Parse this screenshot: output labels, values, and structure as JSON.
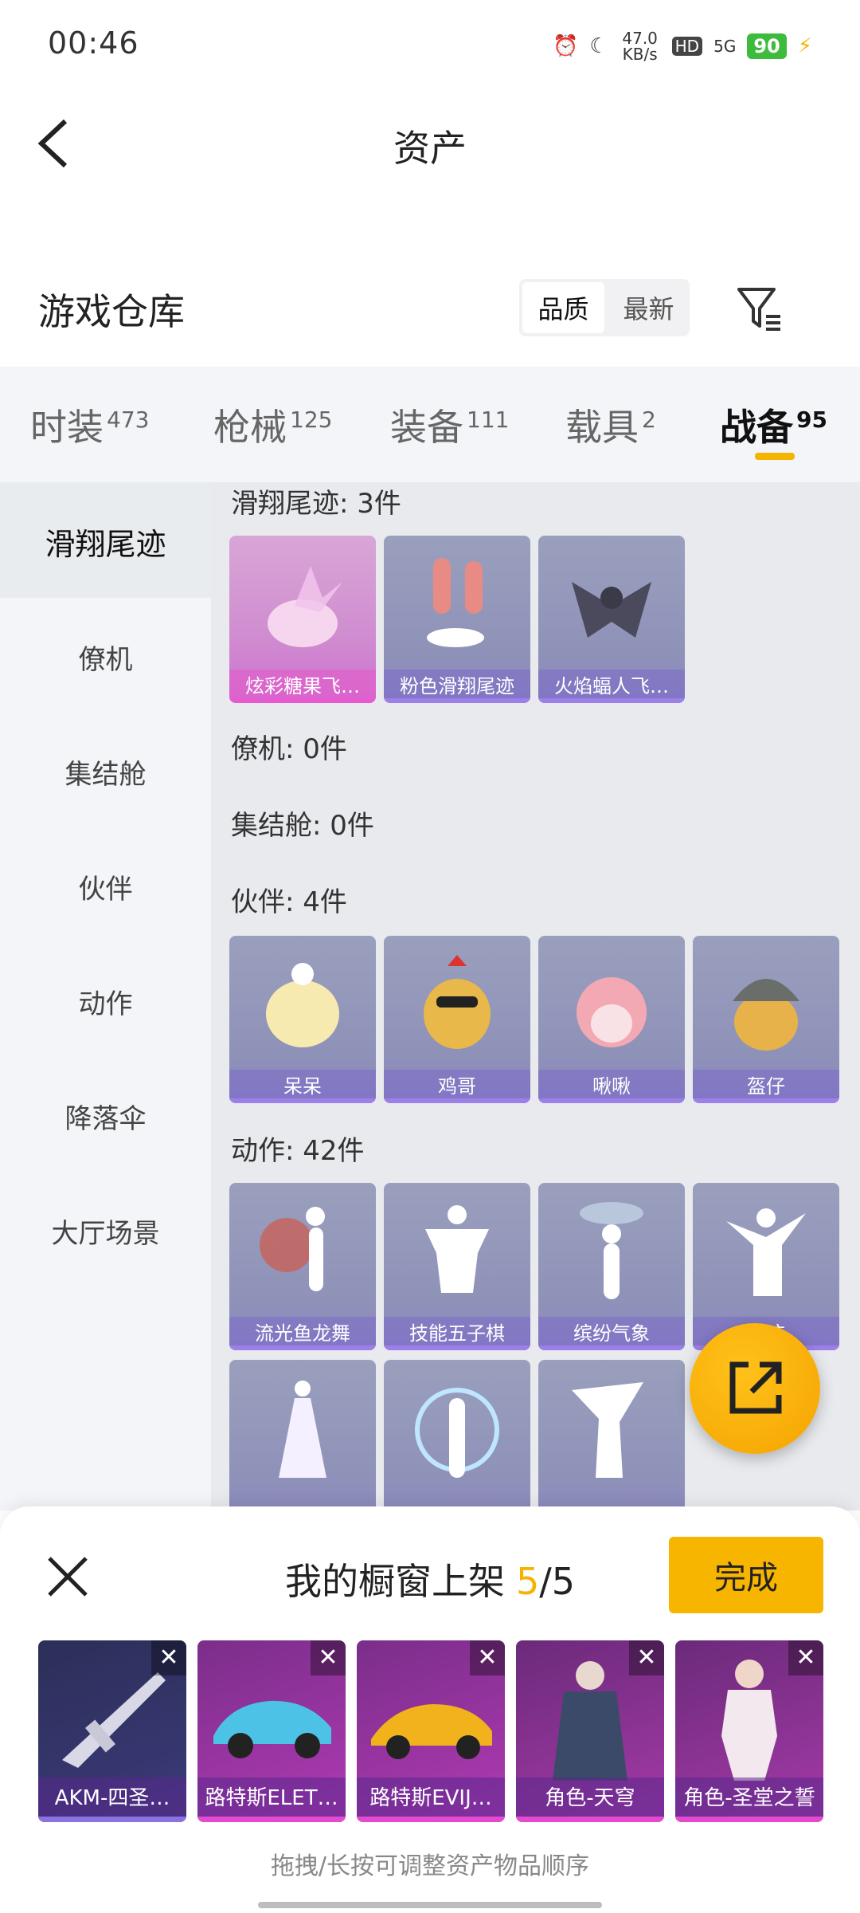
{
  "status": {
    "time": "00:46",
    "net_speed": "47.0 KB/s",
    "hd": "HD",
    "signal": "5G",
    "battery": "90"
  },
  "header": {
    "title": "资产"
  },
  "section": {
    "title": "游戏仓库",
    "sort_options": [
      "品质",
      "最新"
    ],
    "sort_selected": "品质"
  },
  "tabs": [
    {
      "label": "时装",
      "count": "473"
    },
    {
      "label": "枪械",
      "count": "125"
    },
    {
      "label": "装备",
      "count": "111"
    },
    {
      "label": "载具",
      "count": "2"
    },
    {
      "label": "战备",
      "count": "95",
      "active": true
    }
  ],
  "sidebar": {
    "items": [
      "滑翔尾迹",
      "僚机",
      "集结舱",
      "伙伴",
      "动作",
      "降落伞",
      "大厅场景"
    ],
    "active": "滑翔尾迹"
  },
  "content": {
    "groups": [
      {
        "title": "滑翔尾迹: 3件",
        "items": [
          "炫彩糖果飞…",
          "粉色滑翔尾迹",
          "火焰蝠人飞…"
        ]
      },
      {
        "title": "僚机: 0件",
        "items": []
      },
      {
        "title": "集结舱: 0件",
        "items": []
      },
      {
        "title": "伙伴: 4件",
        "items": [
          "呆呆",
          "鸡哥",
          "啾啾",
          "盔仔"
        ]
      },
      {
        "title": "动作: 42件",
        "items": [
          "流光鱼龙舞",
          "技能五子棋",
          "缤纷气象",
          "…迹"
        ]
      }
    ]
  },
  "sheet": {
    "title": "我的橱窗上架",
    "current": "5",
    "total": "/5",
    "done_label": "完成",
    "items": [
      "AKM-四圣…",
      "路特斯ELET…",
      "路特斯EVIJ…",
      "角色-天穹",
      "角色-圣堂之誓"
    ],
    "hint": "拖拽/长按可调整资产物品顺序"
  },
  "colors": {
    "accent": "#f5b400",
    "tab_bg": "#f3f5f8",
    "content_bg": "#e8eaee"
  }
}
